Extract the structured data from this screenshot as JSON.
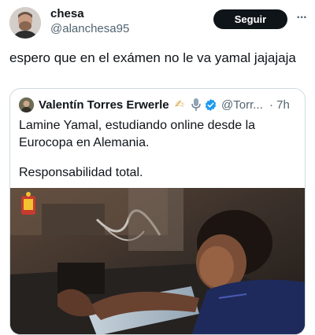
{
  "tweet": {
    "author_name": "chesa",
    "author_handle": "@alanchesa95",
    "follow_label": "Seguir",
    "more_label": "···",
    "text": "espero que en el exámen no le va yamal jajajaja"
  },
  "quote": {
    "author_name": "Valentín Torres Erwerle",
    "emoji": "✍",
    "author_handle": "@Torr...",
    "time": "· 7h",
    "text_line1": "Lamine Yamal, estudiando online desde la Eurocopa en Alemania.",
    "text_line2": "Responsabilidad total."
  },
  "colors": {
    "follow_button": "#0f1419",
    "verified": "#1d9bf0",
    "secondary_text": "#536471",
    "border": "#cfd9de"
  },
  "icons": {
    "more": "more-icon",
    "verified": "verified-badge-icon",
    "mic": "microphone-icon",
    "crest": "federation-crest-icon"
  }
}
